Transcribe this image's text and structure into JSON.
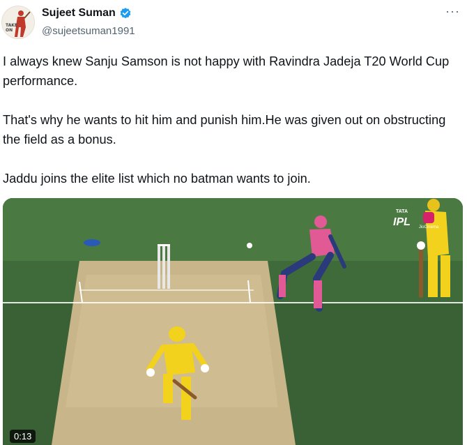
{
  "tweet": {
    "author": {
      "display_name": "Sujeet Suman",
      "handle": "@sujeetsuman1991",
      "verified": true,
      "avatar_icon": "cricketer-avatar-icon",
      "avatar_caption": "TAKE ON"
    },
    "more_label": "···",
    "paragraphs": [
      "I always knew Sanju Samson is not happy with Ravindra Jadeja T20 World Cup performance.",
      "That's why he wants to hit him and punish him.He was given out on obstructing the field as a bonus.",
      "Jaddu joins the elite list which no batman wants to join."
    ],
    "media": {
      "type": "video",
      "timestamp": "0:13",
      "overlay_logo_top": "TATA",
      "overlay_logo_main": "IPL",
      "overlay_secondary": "JioCinema"
    }
  },
  "colors": {
    "verified_badge": "#1d9bf0",
    "text_primary": "#0f1419",
    "text_secondary": "#536471",
    "pitch": "#c9b58a",
    "outfield": "#3f6a3a"
  }
}
